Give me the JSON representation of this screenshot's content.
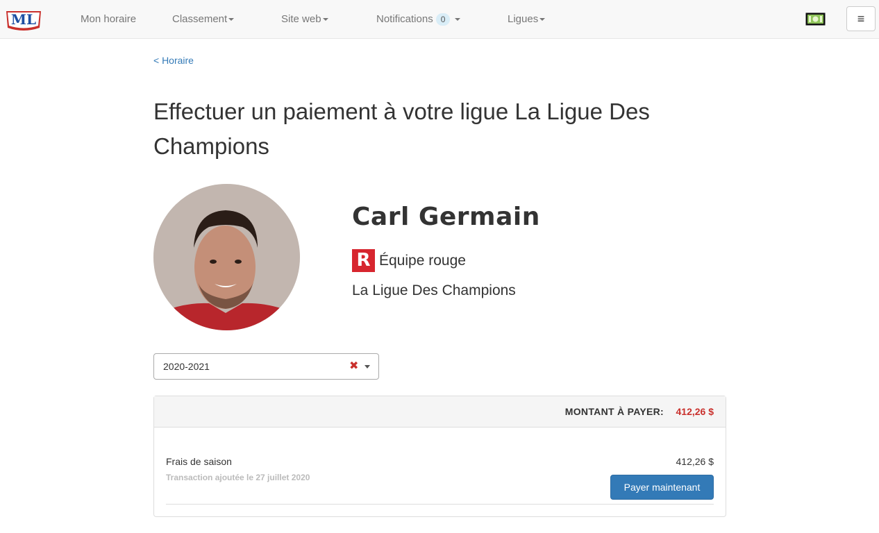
{
  "navbar": {
    "logo_text": "ML",
    "items": [
      {
        "label": "Mon horaire"
      },
      {
        "label": "Classement"
      },
      {
        "label": "Site web"
      },
      {
        "label": "Notifications",
        "badge": "0"
      },
      {
        "label": "Ligues"
      }
    ],
    "right_icons": [
      "money-icon",
      "hamburger-menu-icon"
    ],
    "menu_glyph": "≡"
  },
  "back_link": "< Horaire",
  "page_title": "Effectuer un paiement à votre ligue La Ligue Des Champions",
  "player": {
    "name": "Carl Germain",
    "team_badge": "R",
    "team_name": "Équipe rouge",
    "league": "La Ligue Des Champions"
  },
  "season_select": {
    "value": "2020-2021",
    "clear_glyph": "✖"
  },
  "payment": {
    "due_label": "MONTANT À PAYER:",
    "due_amount": "412,26 $",
    "line_items": [
      {
        "label": "Frais de saison",
        "subtext": "Transaction ajoutée le 27 juillet 2020",
        "amount": "412,26 $",
        "button_label": "Payer maintenant"
      }
    ]
  },
  "colors": {
    "link": "#337ab7",
    "primary_button": "#337ab7",
    "amount_due": "#c9302c",
    "team_red": "#d7262f",
    "navbar_bg": "#f8f8f8"
  }
}
